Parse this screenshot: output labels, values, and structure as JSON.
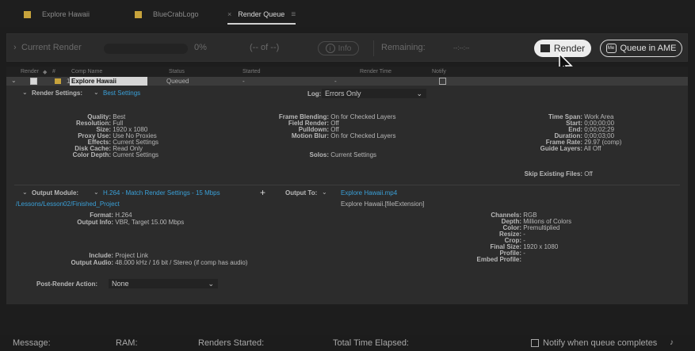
{
  "tabs": [
    {
      "label": "Explore Hawaii"
    },
    {
      "label": "BlueCrabLogo"
    },
    {
      "label": "Render Queue"
    }
  ],
  "toolbar": {
    "current_render": "Current Render",
    "percent": "0%",
    "of": "(-- of --)",
    "info": "Info",
    "remaining": "Remaining:",
    "remaining_value": "--:--:--",
    "render": "Render",
    "queue_ame": "Queue in AME"
  },
  "headers": {
    "render": "Render",
    "tag": "#",
    "comp_name": "Comp Name",
    "status": "Status",
    "started": "Started",
    "render_time": "Render Time",
    "notify": "Notify"
  },
  "queue_item": {
    "number": "1",
    "comp_name": "Explore Hawaii",
    "status": "Queued",
    "started": "-",
    "render_time": "-"
  },
  "render_settings": {
    "label": "Render Settings:",
    "value": "Best Settings",
    "log_label": "Log:",
    "log_value": "Errors Only",
    "col1_keys": [
      "Quality:",
      "Resolution:",
      "Size:",
      "Proxy Use:",
      "Effects:",
      "Disk Cache:",
      "Color Depth:"
    ],
    "col1_vals": [
      "Best",
      "Full",
      "1920 x 1080",
      "Use No Proxies",
      "Current Settings",
      "Read Only",
      "Current Settings"
    ],
    "col2_keys": [
      "Frame Blending:",
      "Field Render:",
      "Pulldown:",
      "Motion Blur:"
    ],
    "col2_vals": [
      "On for Checked Layers",
      "Off",
      "Off",
      "On for Checked Layers"
    ],
    "solos_key": "Solos:",
    "solos_val": "Current Settings",
    "col3_keys": [
      "Time Span:",
      "Start:",
      "End:",
      "Duration:",
      "Frame Rate:",
      "Guide Layers:"
    ],
    "col3_vals": [
      "Work Area",
      "0;00;00;00",
      "0;00;02;29",
      "0;00;03;00",
      "29.97 (comp)",
      "All Off"
    ],
    "skip_key": "Skip Existing Files:",
    "skip_val": "Off"
  },
  "output_module": {
    "label": "Output Module:",
    "value": "H.264 - Match Render Settings - 15 Mbps",
    "path": "/Lessons/Lesson02/Finished_Project",
    "output_to_label": "Output To:",
    "output_to_value": "Explore Hawaii.mp4",
    "file_ext": "Explore Hawaii.[fileExtension]",
    "col1_keys": [
      "Format:",
      "Output Info:"
    ],
    "col1_vals": [
      "H.264",
      "VBR, Target 15.00 Mbps"
    ],
    "include_key": "Include:",
    "include_val": "Project Link",
    "audio_key": "Output Audio:",
    "audio_val": "48.000 kHz / 16 bit / Stereo (if comp has audio)",
    "col3_keys": [
      "Channels:",
      "Depth:",
      "Color:",
      "Resize:",
      "Crop:",
      "Final Size:",
      "Profile:",
      "Embed Profile:"
    ],
    "col3_vals": [
      "RGB",
      "Millions of Colors",
      "Premultiplied",
      "-",
      "-",
      "1920 x 1080",
      "-",
      ""
    ],
    "post_render_label": "Post-Render Action:",
    "post_render_value": "None"
  },
  "statusbar": {
    "message": "Message:",
    "ram": "RAM:",
    "renders_started": "Renders Started:",
    "total_time": "Total Time Elapsed:",
    "notify": "Notify when queue completes"
  },
  "colors": {
    "accent_blue": "#3aa0d8",
    "label_yellow": "#c7a33c"
  }
}
